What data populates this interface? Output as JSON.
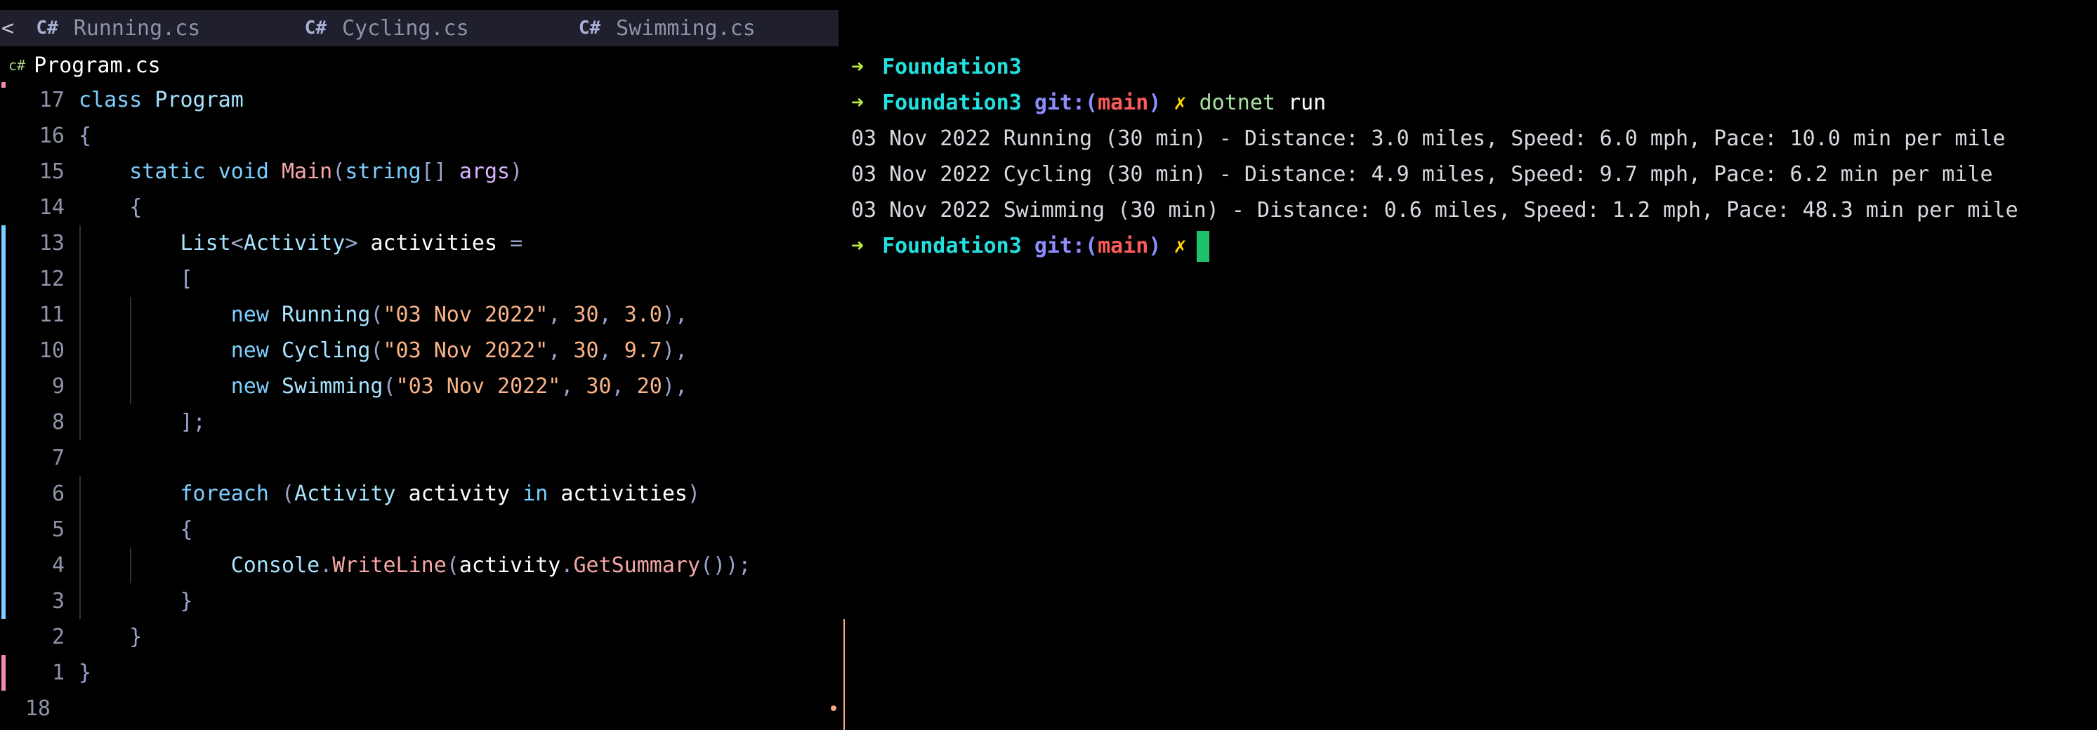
{
  "editor": {
    "tabs": [
      {
        "icon": "C#",
        "label": "Running.cs"
      },
      {
        "icon": "C#",
        "label": "Cycling.cs"
      },
      {
        "icon": "C#",
        "label": "Swimming.cs"
      }
    ],
    "tab_scroll_indicator": "<",
    "winbar": {
      "icon": "c#",
      "filename": "Program.cs"
    },
    "lines": [
      {
        "num": "17",
        "text": "class Program"
      },
      {
        "num": "16",
        "text": "{"
      },
      {
        "num": "15",
        "text": "    static void Main(string[] args)"
      },
      {
        "num": "14",
        "text": "    {"
      },
      {
        "num": "13",
        "text": "        List<Activity> activities ="
      },
      {
        "num": "12",
        "text": "        ["
      },
      {
        "num": "11",
        "text": "            new Running(\"03 Nov 2022\", 30, 3.0),"
      },
      {
        "num": "10",
        "text": "            new Cycling(\"03 Nov 2022\", 30, 9.7),"
      },
      {
        "num": "9",
        "text": "            new Swimming(\"03 Nov 2022\", 30, 20),"
      },
      {
        "num": "8",
        "text": "        ];"
      },
      {
        "num": "7",
        "text": ""
      },
      {
        "num": "6",
        "text": "        foreach (Activity activity in activities)"
      },
      {
        "num": "5",
        "text": "        {"
      },
      {
        "num": "4",
        "text": "            Console.WriteLine(activity.GetSummary());"
      },
      {
        "num": "3",
        "text": "        }"
      },
      {
        "num": "2",
        "text": "    }"
      },
      {
        "num": "1",
        "text": "}"
      },
      {
        "num": "18",
        "text": ""
      }
    ]
  },
  "terminal": {
    "prompt_arrow": "➜",
    "dir": "Foundation3",
    "git_prefix": "git:(",
    "branch": "main",
    "git_suffix": ")",
    "dirty_mark": "✗",
    "command": "dotnet",
    "command_arg": "run",
    "output": [
      "03 Nov 2022 Running (30 min) - Distance: 3.0 miles, Speed: 6.0 mph, Pace: 10.0 min per mile",
      "03 Nov 2022 Cycling (30 min) - Distance: 4.9 miles, Speed: 9.7 mph, Pace: 6.2 min per mile",
      "03 Nov 2022 Swimming (30 min) - Distance: 0.6 miles, Speed: 1.2 mph, Pace: 48.3 min per mile"
    ]
  },
  "colors": {
    "background": "#000000",
    "tabbar": "#1f1f2e",
    "prompt_arrow": "#b8f03c",
    "dir": "#22e0e0",
    "branch": "#ff5a5a",
    "cursor": "#1ec26a"
  }
}
